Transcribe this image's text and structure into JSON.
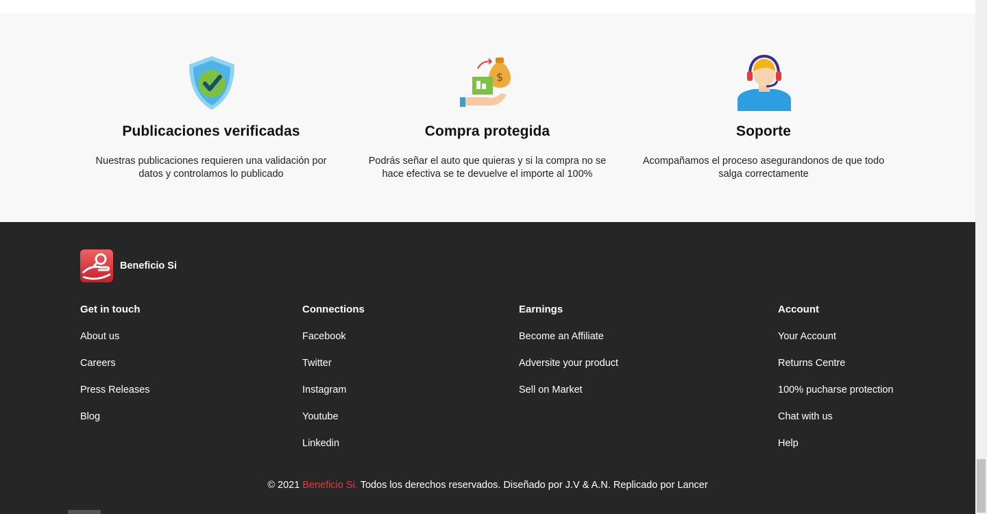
{
  "features": [
    {
      "icon": "shield-check-icon",
      "title": "Publicaciones verificadas",
      "description": "Nuestras publicaciones requieren una validación por datos y controlamos lo publicado"
    },
    {
      "icon": "money-exchange-icon",
      "title": "Compra protegida",
      "description": "Podrás señar el auto que quieras y si la compra no se hace efectiva se te devuelve el importe al 100%"
    },
    {
      "icon": "support-agent-icon",
      "title": "Soporte",
      "description": "Acompañamos el proceso asegurandonos de que todo salga correctamente"
    }
  ],
  "footer": {
    "brand_name": "Beneficio Si",
    "columns": [
      {
        "title": "Get in touch",
        "links": [
          "About us",
          "Careers",
          "Press Releases",
          "Blog"
        ]
      },
      {
        "title": "Connections",
        "links": [
          "Facebook",
          "Twitter",
          "Instagram",
          "Youtube",
          "Linkedin"
        ]
      },
      {
        "title": "Earnings",
        "links": [
          "Become an Affiliate",
          "Adversite your product",
          "Sell on Market"
        ]
      },
      {
        "title": "Account",
        "links": [
          "Your Account",
          "Returns Centre",
          "100% pucharse protection",
          "Chat with us",
          "Help"
        ]
      }
    ],
    "copyright_prefix": "© 2021 ",
    "copyright_brand": "Beneficio Si.",
    "copyright_suffix": " Todos los derechos reservados. Diseñado por J.V & A.N. Replicado por Lancer"
  },
  "colors": {
    "footer_bg": "#262626",
    "features_bg": "#f8f8f8",
    "accent": "#e53b3b"
  }
}
